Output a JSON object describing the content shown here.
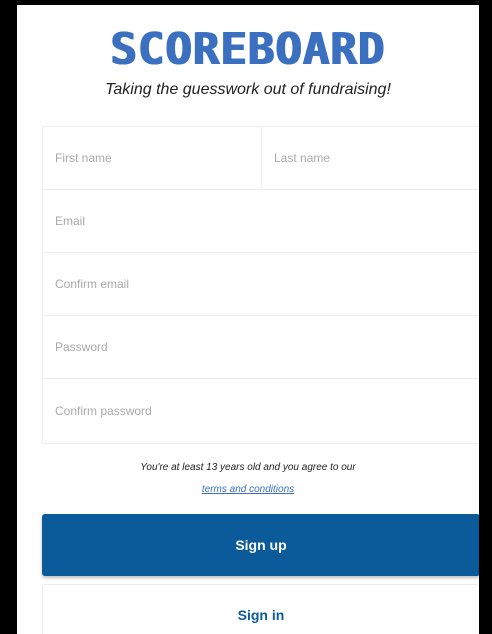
{
  "brand": {
    "logo": "SCOREBOARD",
    "tagline": "Taking the guesswork out of fundraising!"
  },
  "form": {
    "first_name_placeholder": "First name",
    "last_name_placeholder": "Last name",
    "email_placeholder": "Email",
    "confirm_email_placeholder": "Confirm email",
    "password_placeholder": "Password",
    "confirm_password_placeholder": "Confirm password"
  },
  "legal": {
    "age_notice": "You're at least 13 years old and you agree to our",
    "terms_link": "terms and conditions"
  },
  "actions": {
    "sign_up": "Sign up",
    "sign_in": "Sign in"
  },
  "colors": {
    "brand_blue": "#3b6fbf",
    "primary_button": "#0b5a9a"
  }
}
